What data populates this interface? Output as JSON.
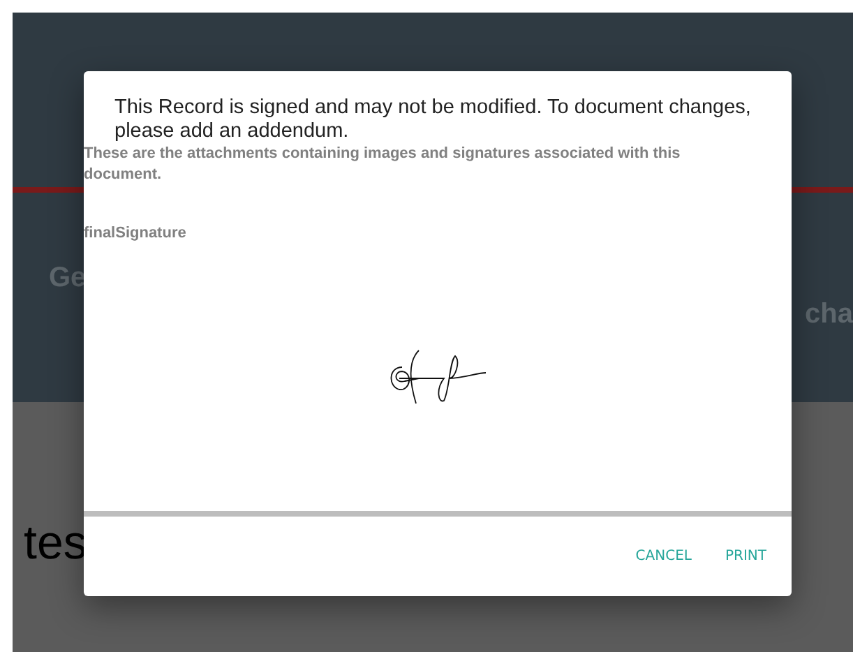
{
  "background": {
    "left_fragment": "Ge",
    "right_fragment": "cha",
    "comment": "tes"
  },
  "dialog": {
    "message": "This Record is signed and may not be modified. To document changes, please add an addendum.",
    "description": "These are the attachments containing images and signatures associated with this document.",
    "attachment_label": "finalSignature",
    "buttons": [
      "CANCEL",
      "PRINT"
    ]
  }
}
